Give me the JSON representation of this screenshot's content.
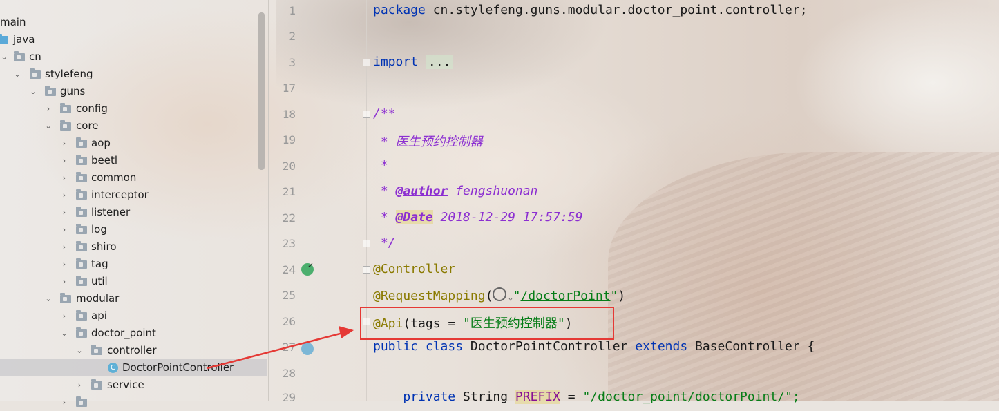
{
  "tree": {
    "items": [
      {
        "label": "main"
      },
      {
        "label": "java"
      },
      {
        "label": "cn"
      },
      {
        "label": "stylefeng"
      },
      {
        "label": "guns"
      },
      {
        "label": "config"
      },
      {
        "label": "core"
      },
      {
        "label": "aop"
      },
      {
        "label": "beetl"
      },
      {
        "label": "common"
      },
      {
        "label": "interceptor"
      },
      {
        "label": "listener"
      },
      {
        "label": "log"
      },
      {
        "label": "shiro"
      },
      {
        "label": "tag"
      },
      {
        "label": "util"
      },
      {
        "label": "modular"
      },
      {
        "label": "api"
      },
      {
        "label": "doctor_point"
      },
      {
        "label": "controller"
      },
      {
        "label": "DoctorPointController"
      },
      {
        "label": "service"
      }
    ]
  },
  "gutter": {
    "line_numbers": [
      "1",
      "2",
      "3",
      "17",
      "18",
      "19",
      "20",
      "21",
      "22",
      "23",
      "24",
      "25",
      "26",
      "27",
      "28",
      "29"
    ]
  },
  "code": {
    "l1_kw": "package",
    "l1_rest": " cn.stylefeng.guns.modular.doctor_point.controller;",
    "l3_kw": "import",
    "l3_fold": "...",
    "l18": "/**",
    "l19": " * 医生预约控制器",
    "l20": " *",
    "l21_star": " * ",
    "l21_tag": "@author",
    "l21_val": " fengshuonan",
    "l22_star": " * ",
    "l22_tag": "@Date",
    "l22_val": " 2018-12-29 17:57:59",
    "l23": " */",
    "l24": "@Controller",
    "l25_ann": "@RequestMapping",
    "l25_open": "(",
    "l25_q1": "\"",
    "l25_path": "/doctorPoint",
    "l25_q2": "\"",
    "l25_close": ")",
    "l26_ann": "@Api",
    "l26_mid": "(tags = ",
    "l26_str": "\"医生预约控制器\"",
    "l26_close": ")",
    "l27_kw1": "public",
    "l27_kw2": "class",
    "l27_name": " DoctorPointController ",
    "l27_kw3": "extends",
    "l27_rest": " BaseController {",
    "l29_indent": "    ",
    "l29_kw": "private",
    "l29_type": " String ",
    "l29_field": "PREFIX",
    "l29_eq": " = ",
    "l29_str": "\"/doctor_point/doctorPoint/\";"
  },
  "colors": {
    "highlight_box": "#e53935",
    "arrow": "#e53935"
  }
}
